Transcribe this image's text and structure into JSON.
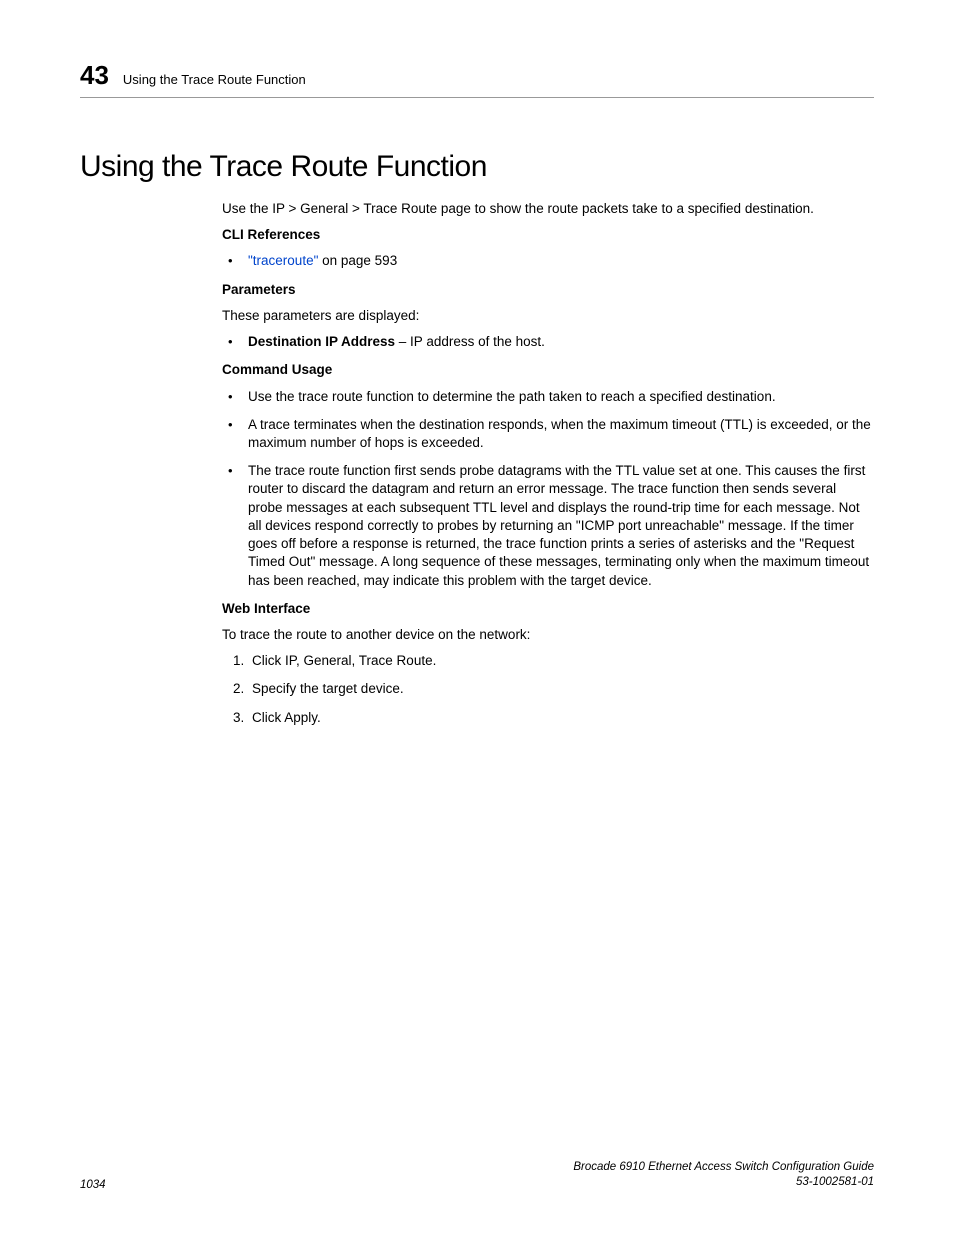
{
  "header": {
    "chapter_number": "43",
    "chapter_title": "Using the Trace Route Function"
  },
  "title": "Using the Trace Route Function",
  "intro": "Use the IP > General > Trace Route page to show the route packets take to a specified destination.",
  "cli_references": {
    "heading": "CLI References",
    "items": [
      {
        "link_text": "\"traceroute\"",
        "suffix": " on page 593"
      }
    ]
  },
  "parameters": {
    "heading": "Parameters",
    "lead": "These parameters are displayed:",
    "items": [
      {
        "name": "Destination IP Address",
        "desc": " – IP address of the host."
      }
    ]
  },
  "command_usage": {
    "heading": "Command Usage",
    "items": [
      "Use the trace route function to determine the path taken to reach a specified destination.",
      "A trace terminates when the destination responds, when the maximum timeout (TTL) is exceeded, or the maximum number of hops is exceeded.",
      "The trace route function first sends probe datagrams with the TTL value set at one. This causes the first router to discard the datagram and return an error message. The trace function then sends several probe messages at each subsequent TTL level and displays the round-trip time for each message. Not all devices respond correctly to probes by returning an \"ICMP port unreachable\" message. If the timer goes off before a response is returned, the trace function prints a series of asterisks and the \"Request Timed Out\" message. A long sequence of these messages, terminating only when the maximum timeout has been reached, may indicate this problem with the target device."
    ]
  },
  "web_interface": {
    "heading": "Web Interface",
    "lead": "To trace the route to another device on the network:",
    "steps": [
      "Click IP, General, Trace Route.",
      "Specify the target device.",
      "Click Apply."
    ]
  },
  "footer": {
    "page_number": "1034",
    "doc_title": "Brocade 6910 Ethernet Access Switch Configuration Guide",
    "doc_number": "53-1002581-01"
  }
}
